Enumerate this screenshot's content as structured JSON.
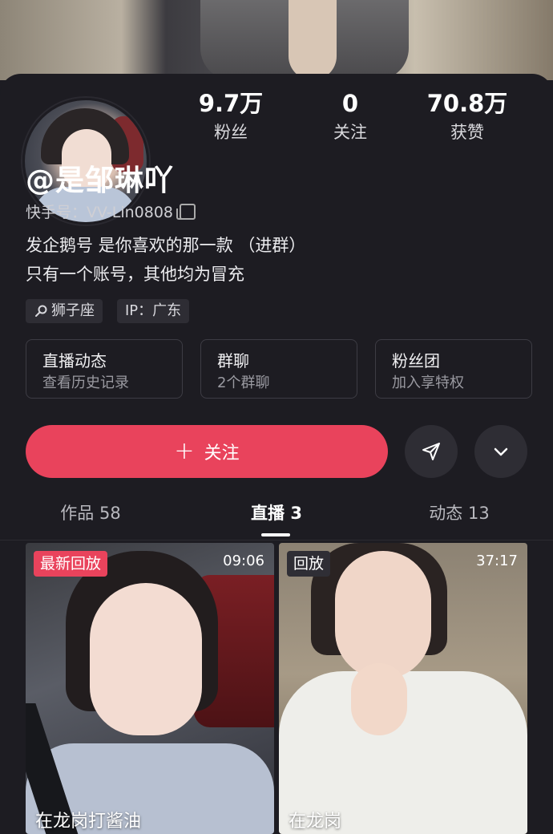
{
  "colors": {
    "accent": "#e9435c",
    "background": "#1d1c22",
    "card_border": "#3d3c44"
  },
  "profile": {
    "name": "@是邹琳吖",
    "kuaishou_id_label": "快手号：VV-Lin0808",
    "bio_lines": [
      "发企鹅号 是你喜欢的那一款  （进群）",
      "只有一个账号，其他均为冒充"
    ]
  },
  "stats": [
    {
      "value": "9.7万",
      "label": "粉丝"
    },
    {
      "value": "0",
      "label": "关注"
    },
    {
      "value": "70.8万",
      "label": "获赞"
    }
  ],
  "tags": [
    {
      "icon": "zodiac-icon",
      "label": "狮子座"
    },
    {
      "label": "IP：广东"
    }
  ],
  "cards": [
    {
      "title": "直播动态",
      "subtitle": "查看历史记录"
    },
    {
      "title": "群聊",
      "subtitle": "2个群聊"
    },
    {
      "title": "粉丝团",
      "subtitle": "加入享特权"
    }
  ],
  "actions": {
    "follow_label": "关注",
    "share_icon": "send-icon",
    "more_icon": "chevron-down-icon"
  },
  "tabs": [
    {
      "label": "作品 58",
      "active": false
    },
    {
      "label": "直播 3",
      "active": true
    },
    {
      "label": "动态 13",
      "active": false
    }
  ],
  "videos": [
    {
      "badge": "最新回放",
      "badge_color": "#e9435c",
      "duration": "09:06",
      "caption": "在龙岗打酱油"
    },
    {
      "badge": "回放",
      "badge_color": "#2f2e35",
      "duration": "37:17",
      "caption": "在龙岗"
    }
  ]
}
